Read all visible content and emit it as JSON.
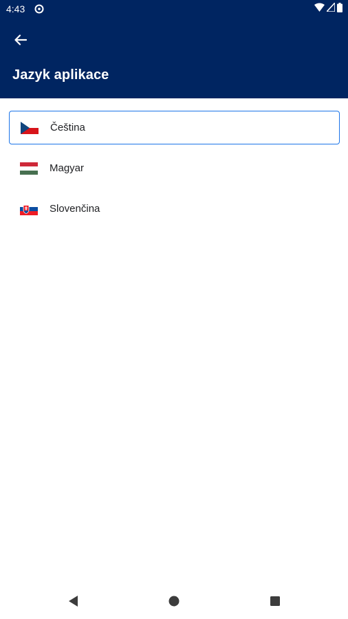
{
  "status_bar": {
    "time": "4:43",
    "icons": [
      "app-notification-icon",
      "wifi-icon",
      "cell-signal-icon",
      "battery-icon"
    ]
  },
  "header": {
    "title": "Jazyk aplikace",
    "back_icon": "back-arrow-icon",
    "background_color": "#002561"
  },
  "languages": [
    {
      "label": "Čeština",
      "flag": "czech-flag-icon",
      "selected": true
    },
    {
      "label": "Magyar",
      "flag": "hungarian-flag-icon",
      "selected": false
    },
    {
      "label": "Slovenčina",
      "flag": "slovak-flag-icon",
      "selected": false
    }
  ],
  "selection_color": "#1a73e8",
  "nav_bar": {
    "icons": [
      "nav-back-icon",
      "nav-home-icon",
      "nav-recents-icon"
    ]
  }
}
